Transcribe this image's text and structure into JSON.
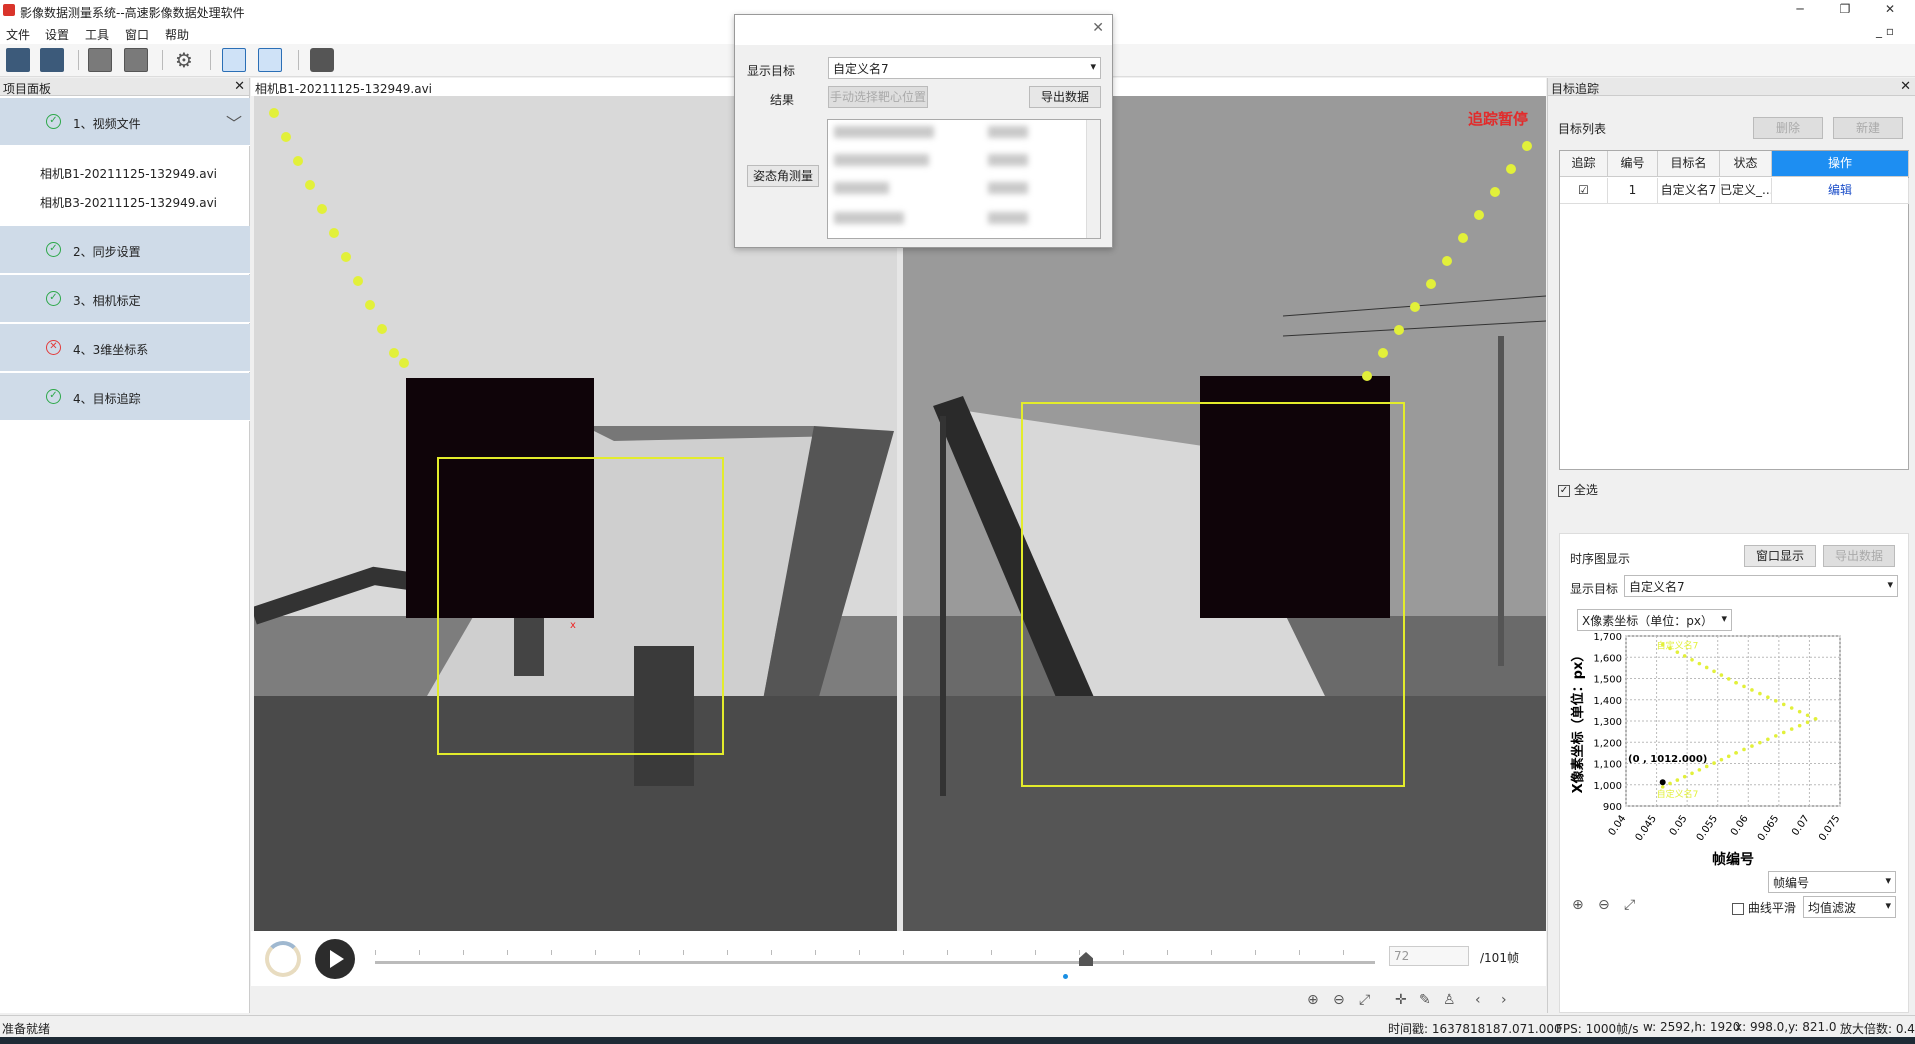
{
  "window": {
    "title": "影像数据测量系统--高速影像数据处理软件"
  },
  "menu": [
    "文件",
    "设置",
    "工具",
    "窗口",
    "帮助"
  ],
  "left_panel": {
    "title": "项目面板",
    "steps": [
      {
        "label": "1、视频文件",
        "status": "ok"
      },
      {
        "label": "2、同步设置",
        "status": "ok"
      },
      {
        "label": "3、相机标定",
        "status": "ok"
      },
      {
        "label": "4、3维坐标系",
        "status": "error"
      },
      {
        "label": "4、目标追踪",
        "status": "ok"
      }
    ],
    "files": [
      "相机B1-20211125-132949.avi",
      "相机B3-20211125-132949.avi"
    ]
  },
  "center": {
    "header": "相机B1-20211125-132949.avi",
    "overlay_text": "追踪暂停",
    "frame_input": "72",
    "frame_total": "/101帧",
    "progress": 0.72
  },
  "dialog": {
    "target_label": "显示目标",
    "target_value": "自定义名7",
    "result_label": "结果",
    "manual_button": "手动选择靶心位置",
    "export_button": "导出数据",
    "attitude_button": "姿态角测量"
  },
  "right_panel": {
    "title": "目标追踪",
    "list_label": "目标列表",
    "delete_button": "删除",
    "new_button": "新建",
    "columns": [
      "追踪",
      "编号",
      "目标名",
      "状态",
      "操作"
    ],
    "rows": [
      {
        "track": "☑",
        "id": "1",
        "name": "自定义名7",
        "status": "已定义_...",
        "action": "编辑"
      }
    ],
    "select_all": "全选",
    "timeseries": {
      "title": "时序图显示",
      "window_button": "窗口显示",
      "export_button": "导出数据",
      "target_label": "显示目标",
      "target_value": "自定义名7",
      "axis_select": "X像素坐标（单位：px）",
      "smooth_label": "曲线平滑",
      "filter_value": "均值滤波",
      "xaxis_select": "帧编号"
    }
  },
  "chart_data": {
    "type": "line",
    "xlabel": "帧编号",
    "ylabel": "X像素坐标（单位：px）",
    "ylim": [
      900,
      1700
    ],
    "xlim": [
      0.04,
      0.075
    ],
    "yticks": [
      "1,700",
      "1,600",
      "1,500",
      "1,400",
      "1,300",
      "1,200",
      "1,100",
      "1,000",
      "900"
    ],
    "xticks": [
      "0.04",
      "0.045",
      "0.05",
      "0.055",
      "0.06",
      "0.065",
      "0.07",
      "0.075"
    ],
    "series": [
      {
        "name": "自定义名7",
        "points": [
          [
            0.046,
            1660
          ],
          [
            0.058,
            1480
          ],
          [
            0.071,
            1310
          ],
          [
            0.058,
            1150
          ],
          [
            0.046,
            990
          ]
        ]
      }
    ],
    "annotation": "(0 , 1012.000)",
    "annotation_point": [
      0.046,
      1012
    ]
  },
  "status": {
    "left": "准备就绪",
    "timestamp": "时间戳: 1637818187.071.000",
    "fps": "FPS: 1000帧/s",
    "size": "w: 2592,h: 1920",
    "coords": "x: 998.0,y: 821.0",
    "zoom": "放大倍数: 0.4"
  }
}
